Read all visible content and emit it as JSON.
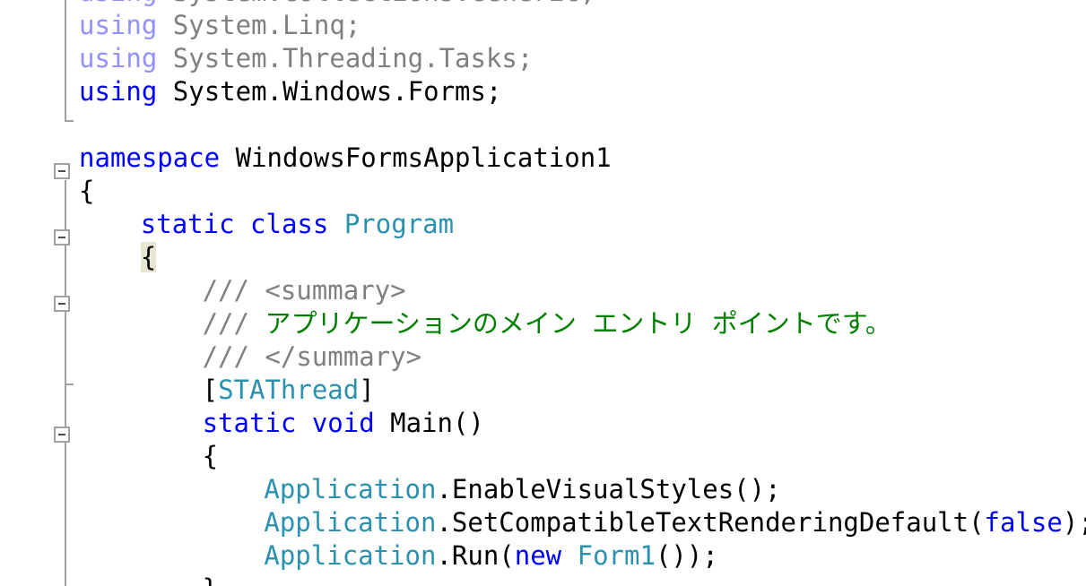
{
  "editor": {
    "lines": [
      {
        "id": "l0",
        "indent": 0,
        "tokens": [
          {
            "t": "using",
            "c": "kw-dim"
          },
          {
            "t": " "
          },
          {
            "t": "System.Collections.Generic;",
            "c": "dim"
          }
        ]
      },
      {
        "id": "l1",
        "indent": 0,
        "tokens": [
          {
            "t": "using",
            "c": "kw-dim"
          },
          {
            "t": " "
          },
          {
            "t": "System.Linq;",
            "c": "dim"
          }
        ]
      },
      {
        "id": "l2",
        "indent": 0,
        "tokens": [
          {
            "t": "using",
            "c": "kw-dim"
          },
          {
            "t": " "
          },
          {
            "t": "System.Threading.Tasks;",
            "c": "dim"
          }
        ]
      },
      {
        "id": "l3",
        "indent": 0,
        "tokens": [
          {
            "t": "using",
            "c": "kw"
          },
          {
            "t": " "
          },
          {
            "t": "System.Windows.Forms;"
          }
        ]
      },
      {
        "id": "l4",
        "indent": 0,
        "tokens": []
      },
      {
        "id": "l5",
        "indent": 0,
        "tokens": [
          {
            "t": "namespace",
            "c": "kw"
          },
          {
            "t": " WindowsFormsApplication1"
          }
        ]
      },
      {
        "id": "l6",
        "indent": 0,
        "tokens": [
          {
            "t": "{"
          }
        ]
      },
      {
        "id": "l7",
        "indent": 4,
        "tokens": [
          {
            "t": "static",
            "c": "kw"
          },
          {
            "t": " "
          },
          {
            "t": "class",
            "c": "kw"
          },
          {
            "t": " "
          },
          {
            "t": "Program",
            "c": "type"
          }
        ]
      },
      {
        "id": "l8",
        "indent": 4,
        "tokens": [
          {
            "t": "{",
            "c": "brace-hl"
          }
        ]
      },
      {
        "id": "l9",
        "indent": 8,
        "tokens": [
          {
            "t": "/// <summary>",
            "c": "doc"
          }
        ]
      },
      {
        "id": "l10",
        "indent": 8,
        "tokens": [
          {
            "t": "/// ",
            "c": "doc"
          },
          {
            "t": "アプリケーションのメイン エントリ ポイントです。",
            "c": "cm"
          }
        ]
      },
      {
        "id": "l11",
        "indent": 8,
        "tokens": [
          {
            "t": "/// </summary>",
            "c": "doc"
          }
        ]
      },
      {
        "id": "l12",
        "indent": 8,
        "tokens": [
          {
            "t": "["
          },
          {
            "t": "STAThread",
            "c": "type"
          },
          {
            "t": "]"
          }
        ]
      },
      {
        "id": "l13",
        "indent": 8,
        "tokens": [
          {
            "t": "static",
            "c": "kw"
          },
          {
            "t": " "
          },
          {
            "t": "void",
            "c": "kw"
          },
          {
            "t": " Main()"
          }
        ]
      },
      {
        "id": "l14",
        "indent": 8,
        "tokens": [
          {
            "t": "{"
          }
        ]
      },
      {
        "id": "l15",
        "indent": 12,
        "tokens": [
          {
            "t": "Application",
            "c": "type"
          },
          {
            "t": ".EnableVisualStyles();"
          }
        ]
      },
      {
        "id": "l16",
        "indent": 12,
        "tokens": [
          {
            "t": "Application",
            "c": "type"
          },
          {
            "t": ".SetCompatibleTextRenderingDefault("
          },
          {
            "t": "false",
            "c": "kw"
          },
          {
            "t": ");"
          }
        ]
      },
      {
        "id": "l17",
        "indent": 12,
        "tokens": [
          {
            "t": "Application",
            "c": "type"
          },
          {
            "t": ".Run("
          },
          {
            "t": "new",
            "c": "kw"
          },
          {
            "t": " "
          },
          {
            "t": "Form1",
            "c": "type"
          },
          {
            "t": "());"
          }
        ]
      },
      {
        "id": "l18",
        "indent": 8,
        "tokens": [
          {
            "t": "}"
          }
        ]
      }
    ]
  },
  "icons": {
    "fold": "collapse-minus-icon"
  },
  "colors": {
    "keyword": "#0000ff",
    "keyword_faded": "#9191ff",
    "faded_text": "#808080",
    "type": "#2b91af",
    "comment": "#008000",
    "doc_comment": "#808080",
    "brace_highlight": "#e6e6d2",
    "outline": "#a0a0a0"
  }
}
